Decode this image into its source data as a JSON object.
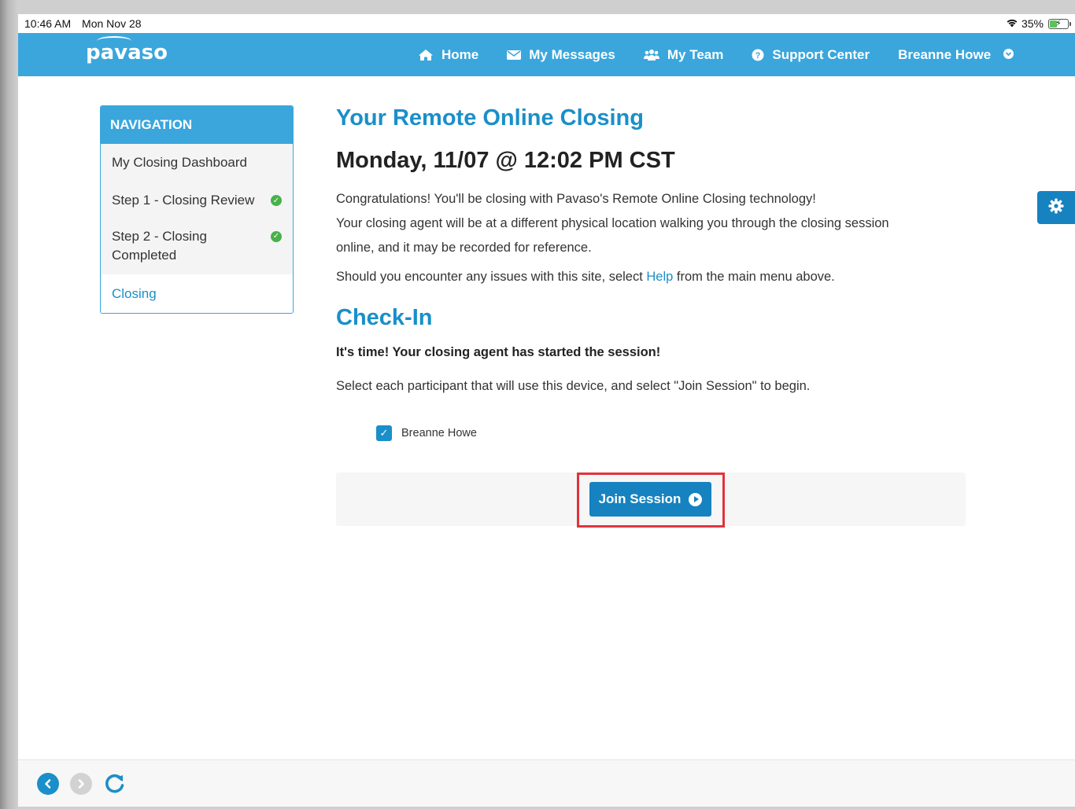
{
  "statusbar": {
    "time": "10:46 AM",
    "date": "Mon Nov 28",
    "battery_percent": "35%",
    "icons": [
      "wifi-icon",
      "battery-icon"
    ]
  },
  "topnav": {
    "logo_text": "pavaso",
    "links": [
      {
        "label": "Home",
        "icon": "home-icon"
      },
      {
        "label": "My Messages",
        "icon": "envelope-icon"
      },
      {
        "label": "My Team",
        "icon": "team-icon"
      },
      {
        "label": "Support Center",
        "icon": "question-circle-icon"
      }
    ],
    "user_name": "Breanne Howe",
    "colors": {
      "bar": "#3aa6dc"
    }
  },
  "sidebar": {
    "header": "NAVIGATION",
    "items": [
      {
        "label": "My Closing Dashboard",
        "completed": false
      },
      {
        "label": "Step 1 - Closing Review",
        "completed": true
      },
      {
        "label": "Step 2 - Closing Completed",
        "label_line1": "Step 2 - Closing",
        "label_line2": "Completed",
        "completed": true
      },
      {
        "label": "Closing",
        "active": true
      }
    ]
  },
  "main": {
    "title": "Your Remote Online Closing",
    "datetime": "Monday, 11/07 @ 12:02 PM CST",
    "intro_line1": "Congratulations! You'll be closing with Pavaso's Remote Online Closing technology!",
    "intro_line2": "Your closing agent will be at a different physical location walking you through the closing session",
    "intro_line3": "online, and it may be recorded for reference.",
    "help_prefix": "Should you encounter any issues with this site, select ",
    "help_link": "Help",
    "help_suffix": " from the main menu above.",
    "checkin_title": "Check-In",
    "checkin_status": "It's time! Your closing agent has started the session!",
    "checkin_instructions": "Select each participant that will use this device, and select \"Join Session\" to begin.",
    "participants": [
      {
        "name": "Breanne Howe",
        "checked": true
      }
    ],
    "join_button_label": "Join Session",
    "colors": {
      "accent": "#1a8fc9",
      "button": "#1682c0",
      "highlight": "#e0333b",
      "check_green": "#49b14a"
    }
  },
  "bottombar": {
    "icons": [
      "back-arrow-icon",
      "forward-arrow-icon",
      "refresh-icon"
    ]
  }
}
